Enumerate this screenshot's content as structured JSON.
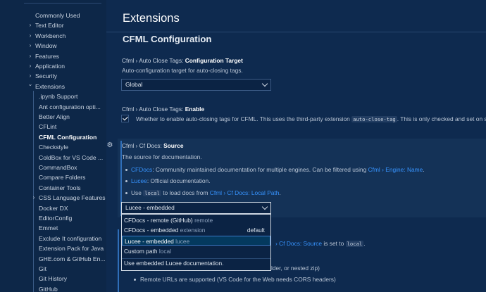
{
  "sidebar": {
    "items": [
      {
        "label": "Commonly Used",
        "indent": 0,
        "chevron": false
      },
      {
        "label": "Text Editor",
        "indent": 0,
        "chevron": true
      },
      {
        "label": "Workbench",
        "indent": 0,
        "chevron": true
      },
      {
        "label": "Window",
        "indent": 0,
        "chevron": true
      },
      {
        "label": "Features",
        "indent": 0,
        "chevron": true
      },
      {
        "label": "Application",
        "indent": 0,
        "chevron": true
      },
      {
        "label": "Security",
        "indent": 0,
        "chevron": true
      },
      {
        "label": "Extensions",
        "indent": 0,
        "chevron": true,
        "expanded": true
      },
      {
        "label": ".ipynb Support",
        "indent": 1,
        "chevron": false
      },
      {
        "label": "Ant configuration opti...",
        "indent": 1,
        "chevron": false
      },
      {
        "label": "Better Align",
        "indent": 1,
        "chevron": false
      },
      {
        "label": "CFLint",
        "indent": 1,
        "chevron": false
      },
      {
        "label": "CFML Configuration",
        "indent": 1,
        "chevron": false,
        "active": true
      },
      {
        "label": "Checkstyle",
        "indent": 1,
        "chevron": false
      },
      {
        "label": "ColdBox for VS Code ...",
        "indent": 1,
        "chevron": false
      },
      {
        "label": "CommandBox",
        "indent": 1,
        "chevron": false
      },
      {
        "label": "Compare Folders",
        "indent": 1,
        "chevron": false
      },
      {
        "label": "Container Tools",
        "indent": 1,
        "chevron": false
      },
      {
        "label": "CSS Language Features",
        "indent": 1,
        "chevron": true
      },
      {
        "label": "Docker DX",
        "indent": 1,
        "chevron": false
      },
      {
        "label": "EditorConfig",
        "indent": 1,
        "chevron": false
      },
      {
        "label": "Emmet",
        "indent": 1,
        "chevron": false
      },
      {
        "label": "Exclude It configuration",
        "indent": 1,
        "chevron": false
      },
      {
        "label": "Extension Pack for Java",
        "indent": 1,
        "chevron": false
      },
      {
        "label": "GHE.com & GitHub En...",
        "indent": 1,
        "chevron": false
      },
      {
        "label": "Git",
        "indent": 1,
        "chevron": false
      },
      {
        "label": "Git History",
        "indent": 1,
        "chevron": false
      },
      {
        "label": "GitHub",
        "indent": 1,
        "chevron": false
      }
    ]
  },
  "main": {
    "page_title": "Extensions",
    "section_title": "CFML Configuration",
    "setting1": {
      "prefix": "Cfml › Auto Close Tags: ",
      "name": "Configuration Target",
      "description": "Auto-configuration target for auto-closing tags.",
      "value": "Global"
    },
    "setting2": {
      "prefix": "Cfml › Auto Close Tags: ",
      "name": "Enable",
      "description_pre": "Whether to enable auto-closing tags for CFML. This uses the third-party extension ",
      "description_code": "auto-close-tag",
      "description_post": ". This is only checked and set on s",
      "checked": true
    },
    "setting3": {
      "prefix": "Cfml › Cf Docs: ",
      "name": "Source",
      "description": "The source for documentation.",
      "bullets": [
        {
          "link": "CFDocs",
          "text": ": Community maintained documentation for multiple engines. Can be filtered using ",
          "link2": "Cfml › Engine: Name",
          "post": "."
        },
        {
          "link": "Lucee",
          "text": ": Official documentation.",
          "link2": "",
          "post": ""
        },
        {
          "pre": "Use ",
          "code": "local",
          "text": " to load docs from ",
          "link2": "Cfml › Cf Docs: Local Path",
          "post": "."
        }
      ],
      "value": "Lucee - embedded"
    },
    "dropdown": {
      "options": [
        {
          "label": "CFDocs - remote (GitHub)",
          "sub": "remote",
          "default": ""
        },
        {
          "label": "CFDocs - embedded",
          "sub": "extension",
          "default": "default"
        },
        {
          "label": "Lucee - embedded",
          "sub": "lucee",
          "default": "",
          "selected": true
        },
        {
          "label": "Custom path",
          "sub": "local",
          "default": ""
        }
      ],
      "description": "Use embedded Lucee documentation."
    },
    "below": {
      "frag1_link": "› Cf Docs: Source",
      "frag1_text": " is set to ",
      "frag1_code": "local",
      "frag1_post": ".",
      "frag2": "lder, or nested zip)",
      "frag3_bullet": "Remote URLs are supported (VS Code for the Web needs CORS headers)"
    }
  },
  "colors": {
    "background": "#0e2a4f",
    "sidebar": "#0d2748",
    "link": "#3794ff",
    "selection": "#04395e"
  }
}
